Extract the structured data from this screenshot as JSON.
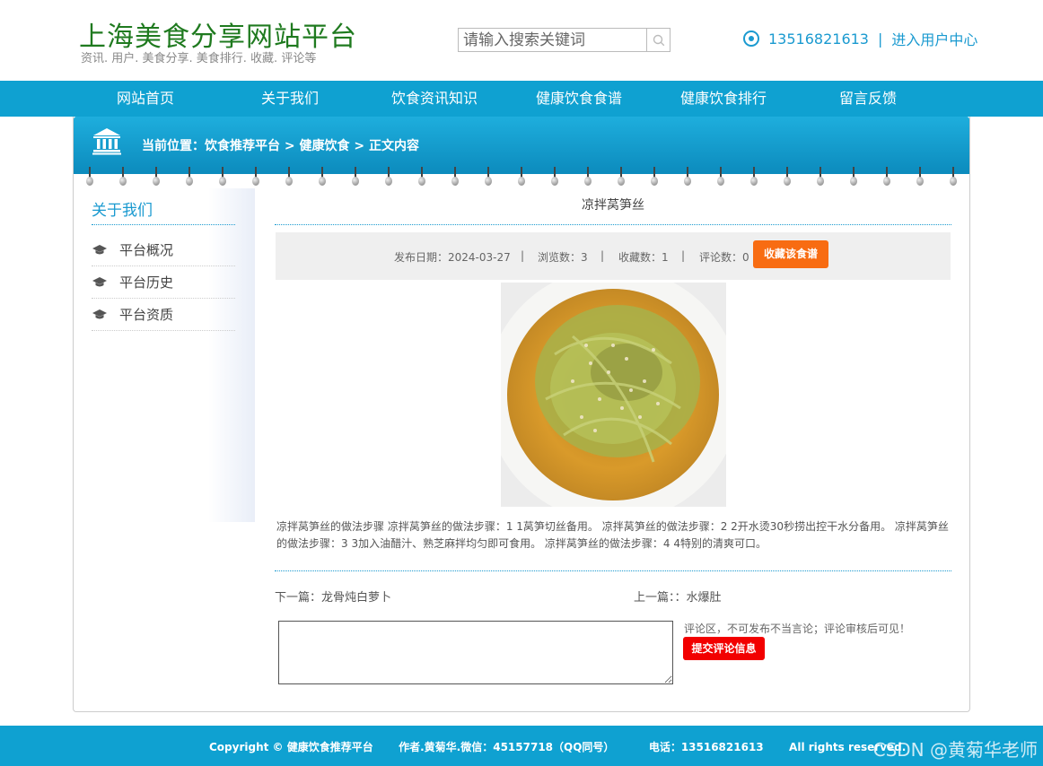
{
  "header": {
    "site_title": "上海美食分享网站平台",
    "site_subtitle": "资讯. 用户. 美食分享. 美食排行. 收藏. 评论等",
    "search_placeholder": "请输入搜索关键词",
    "phone": "13516821613",
    "separator": "|",
    "user_center": "进入用户中心"
  },
  "nav": {
    "items": [
      "网站首页",
      "关于我们",
      "饮食资讯知识",
      "健康饮食食谱",
      "健康饮食排行",
      "留言反馈"
    ]
  },
  "banner": {
    "breadcrumb": "当前位置：饮食推荐平台 > 健康饮食 > 正文内容"
  },
  "sidebar": {
    "title": "关于我们",
    "items": [
      "平台概况",
      "平台历史",
      "平台资质"
    ]
  },
  "article": {
    "title": "凉拌莴笋丝",
    "publish_date": "发布日期：2024-03-27",
    "views": "浏览数：3",
    "favorites": "收藏数：1",
    "comments": "评论数：0",
    "meta_sep": "|",
    "favorite_button": "收藏该食谱",
    "body": "凉拌莴笋丝的做法步骤 凉拌莴笋丝的做法步骤：1 1莴笋切丝备用。 凉拌莴笋丝的做法步骤：2 2开水烫30秒捞出控干水分备用。 凉拌莴笋丝的做法步骤：3 3加入油醋汁、熟芝麻拌均匀即可食用。 凉拌莴笋丝的做法步骤：4 4特别的清爽可口。",
    "next": "下一篇：龙骨炖白萝卜",
    "prev": "上一篇：：水爆肚"
  },
  "comment": {
    "hint": "评论区，不可发布不当言论；评论审核后可见！",
    "submit_button": "提交评论信息"
  },
  "footer": {
    "copyright": "Copyright © 健康饮食推荐平台",
    "author": "作者.黄菊华.微信：45157718（QQ同号）",
    "tel": "电话：13516821613",
    "rights": "All rights reserved.",
    "watermark": "CSDN @黄菊华老师"
  },
  "colors": {
    "nav_blue": "#0fa1d1",
    "title_green": "#1f7a1f",
    "favorite_orange": "#f86c12",
    "submit_red": "#f20000"
  }
}
